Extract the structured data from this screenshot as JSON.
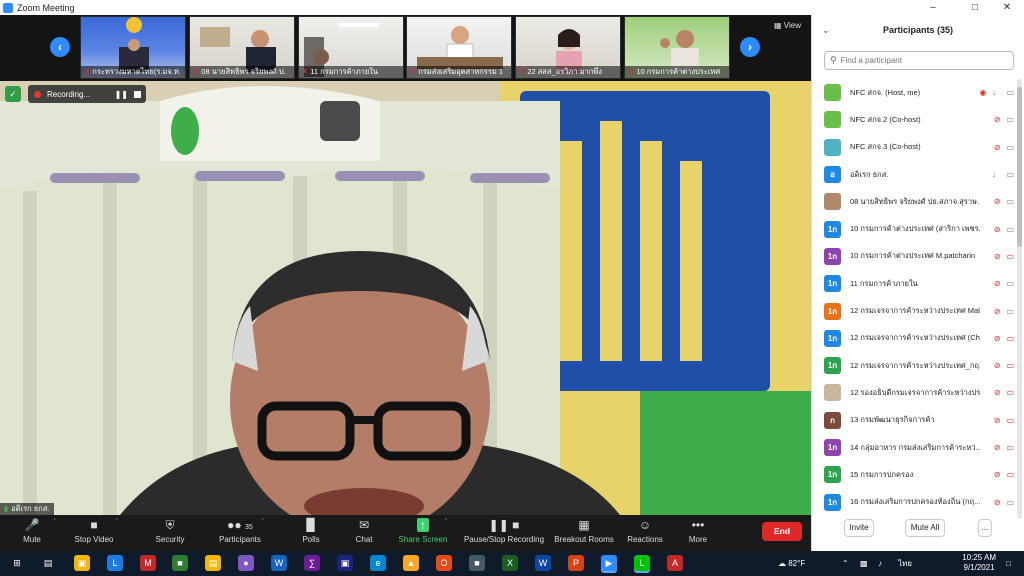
{
  "window": {
    "title": "Zoom Meeting"
  },
  "thumbnails": [
    {
      "name": "กระทรวงมหาดไทย(ร.มจ.ท.",
      "muted": true
    },
    {
      "name": "08 นายสิทธิพร จริยพงศ์ ป.",
      "muted": true
    },
    {
      "name": "11 กรมการค้าภายใน",
      "muted": true
    },
    {
      "name": "กรมส่งเสริมอุตสาหกรรม 1",
      "muted": true
    },
    {
      "name": "22 สสส_อรวิภา มากพึ่ง",
      "muted": true
    },
    {
      "name": "10 กรมการค้าต่างประเทศ",
      "muted": true
    }
  ],
  "view_label": "View",
  "recording": {
    "label": "Recording..."
  },
  "active_speaker": {
    "name": "อดิเรก ธกส."
  },
  "controls": {
    "mute": "Mute",
    "stop_video": "Stop Video",
    "security": "Security",
    "participants": "Participants",
    "participants_count": "35",
    "polls": "Polls",
    "chat": "Chat",
    "share_screen": "Share Screen",
    "pause_stop_recording": "Pause/Stop Recording",
    "breakout_rooms": "Breakout Rooms",
    "reactions": "Reactions",
    "more": "More",
    "end": "End"
  },
  "panel": {
    "title": "Participants (35)",
    "search_placeholder": "Find a participant",
    "invite": "Invite",
    "mute_all": "Mute All",
    "more": "..."
  },
  "participants": [
    {
      "name": "NFC สกจ. (Host, me)",
      "avatar": "",
      "color": "#6abf4b",
      "mic": "on",
      "cam": "on",
      "recording": true
    },
    {
      "name": "NFC สกจ.2 (Co-host)",
      "avatar": "",
      "color": "#6abf4b",
      "mic": "off",
      "cam": "on"
    },
    {
      "name": "NFC สกจ.3 (Co-host)",
      "avatar": "",
      "color": "#4fb3c4",
      "mic": "off",
      "cam": "on"
    },
    {
      "name": "อดิเรก ธกส.",
      "avatar": "อ",
      "color": "#1e88e5",
      "mic": "on",
      "cam": "on"
    },
    {
      "name": "08 นายสิทธิพร จริยพงศ์ ปธ.สภาจ.สุราษ...",
      "avatar": "",
      "color": "#b08968",
      "mic": "off",
      "cam": "on"
    },
    {
      "name": "10 กรมการค้าต่างประเทศ (สาริกา เพชร...",
      "avatar": "1ก",
      "color": "#1e88e5",
      "mic": "off",
      "cam": "on"
    },
    {
      "name": "10 กรมการค้าต่างประเทศ M.patcharin",
      "avatar": "1ก",
      "color": "#8e44ad",
      "mic": "off",
      "cam": "off"
    },
    {
      "name": "11 กรมการค้าภายใน",
      "avatar": "1ก",
      "color": "#1e88e5",
      "mic": "off",
      "cam": "on"
    },
    {
      "name": "12 กรมเจรจาการค้าระหว่างประเทศ Malai_...",
      "avatar": "1ก",
      "color": "#e8711a",
      "mic": "off",
      "cam": "on"
    },
    {
      "name": "12 กรมเจรจาการค้าระหว่างประเทศ (Chonti...",
      "avatar": "1ก",
      "color": "#1e88e5",
      "mic": "off",
      "cam": "off"
    },
    {
      "name": "12 กรมเจรจาการค้าระหว่างประเทศ_กฤ...",
      "avatar": "1ก",
      "color": "#2ea44f",
      "mic": "off",
      "cam": "off"
    },
    {
      "name": "12 รองอธิบดีกรมเจรจาการค้าระหว่างปร...",
      "avatar": "",
      "color": "#c9b79c",
      "mic": "off",
      "cam": "off"
    },
    {
      "name": "13 กรมพัฒนาธุรกิจการค้า",
      "avatar": "ก",
      "color": "#7b4a3a",
      "mic": "off",
      "cam": "off"
    },
    {
      "name": "14 กลุ่มอาหาร กรมส่งเสริมการค้าระหว่...",
      "avatar": "1ก",
      "color": "#8e44ad",
      "mic": "off",
      "cam": "off"
    },
    {
      "name": "15 กรมการปกครอง",
      "avatar": "1ก",
      "color": "#2ea44f",
      "mic": "off",
      "cam": "off"
    },
    {
      "name": "16 กรมส่งเสริมการปกครองท้องถิ่น (กฤ...",
      "avatar": "1ก",
      "color": "#1e88e5",
      "mic": "off",
      "cam": "on"
    }
  ],
  "taskbar": {
    "temperature": "82°F",
    "language": "ไทย",
    "time": "10:25 AM",
    "date": "9/1/2021"
  }
}
